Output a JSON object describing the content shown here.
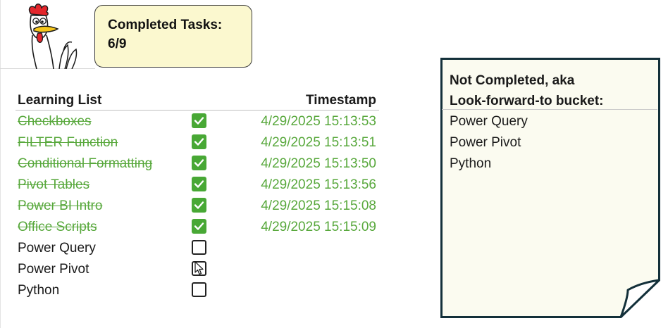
{
  "counter": {
    "label": "Completed Tasks:",
    "value": "6/9"
  },
  "list": {
    "header_task": "Learning List",
    "header_timestamp": "Timestamp",
    "rows": [
      {
        "task": "Checkboxes",
        "checked": true,
        "timestamp": "4/29/2025 15:13:53"
      },
      {
        "task": "FILTER Function",
        "checked": true,
        "timestamp": "4/29/2025 15:13:51"
      },
      {
        "task": "Conditional Formatting",
        "checked": true,
        "timestamp": "4/29/2025 15:13:50"
      },
      {
        "task": "Pivot Tables",
        "checked": true,
        "timestamp": "4/29/2025 15:13:56"
      },
      {
        "task": "Power BI Intro",
        "checked": true,
        "timestamp": "4/29/2025 15:15:08"
      },
      {
        "task": "Office Scripts",
        "checked": true,
        "timestamp": "4/29/2025 15:15:09"
      },
      {
        "task": "Power Query",
        "checked": false,
        "timestamp": ""
      },
      {
        "task": "Power Pivot",
        "checked": false,
        "timestamp": ""
      },
      {
        "task": "Python",
        "checked": false,
        "timestamp": ""
      }
    ]
  },
  "note": {
    "title_line1": "Not Completed, aka",
    "title_line2": "Look-forward-to bucket:",
    "items": [
      "Power Query",
      "Power Pivot",
      "Python"
    ]
  },
  "colors": {
    "done_green": "#58a83c",
    "checkbox_green": "#48a835",
    "note_background": "#fbfbf0",
    "note_border": "#13303a",
    "counter_background": "#fbf8cf"
  },
  "icons": {
    "mascot": "chicken-mascot-icon",
    "checked": "checkmark-icon",
    "pointer": "mouse-cursor-icon"
  }
}
